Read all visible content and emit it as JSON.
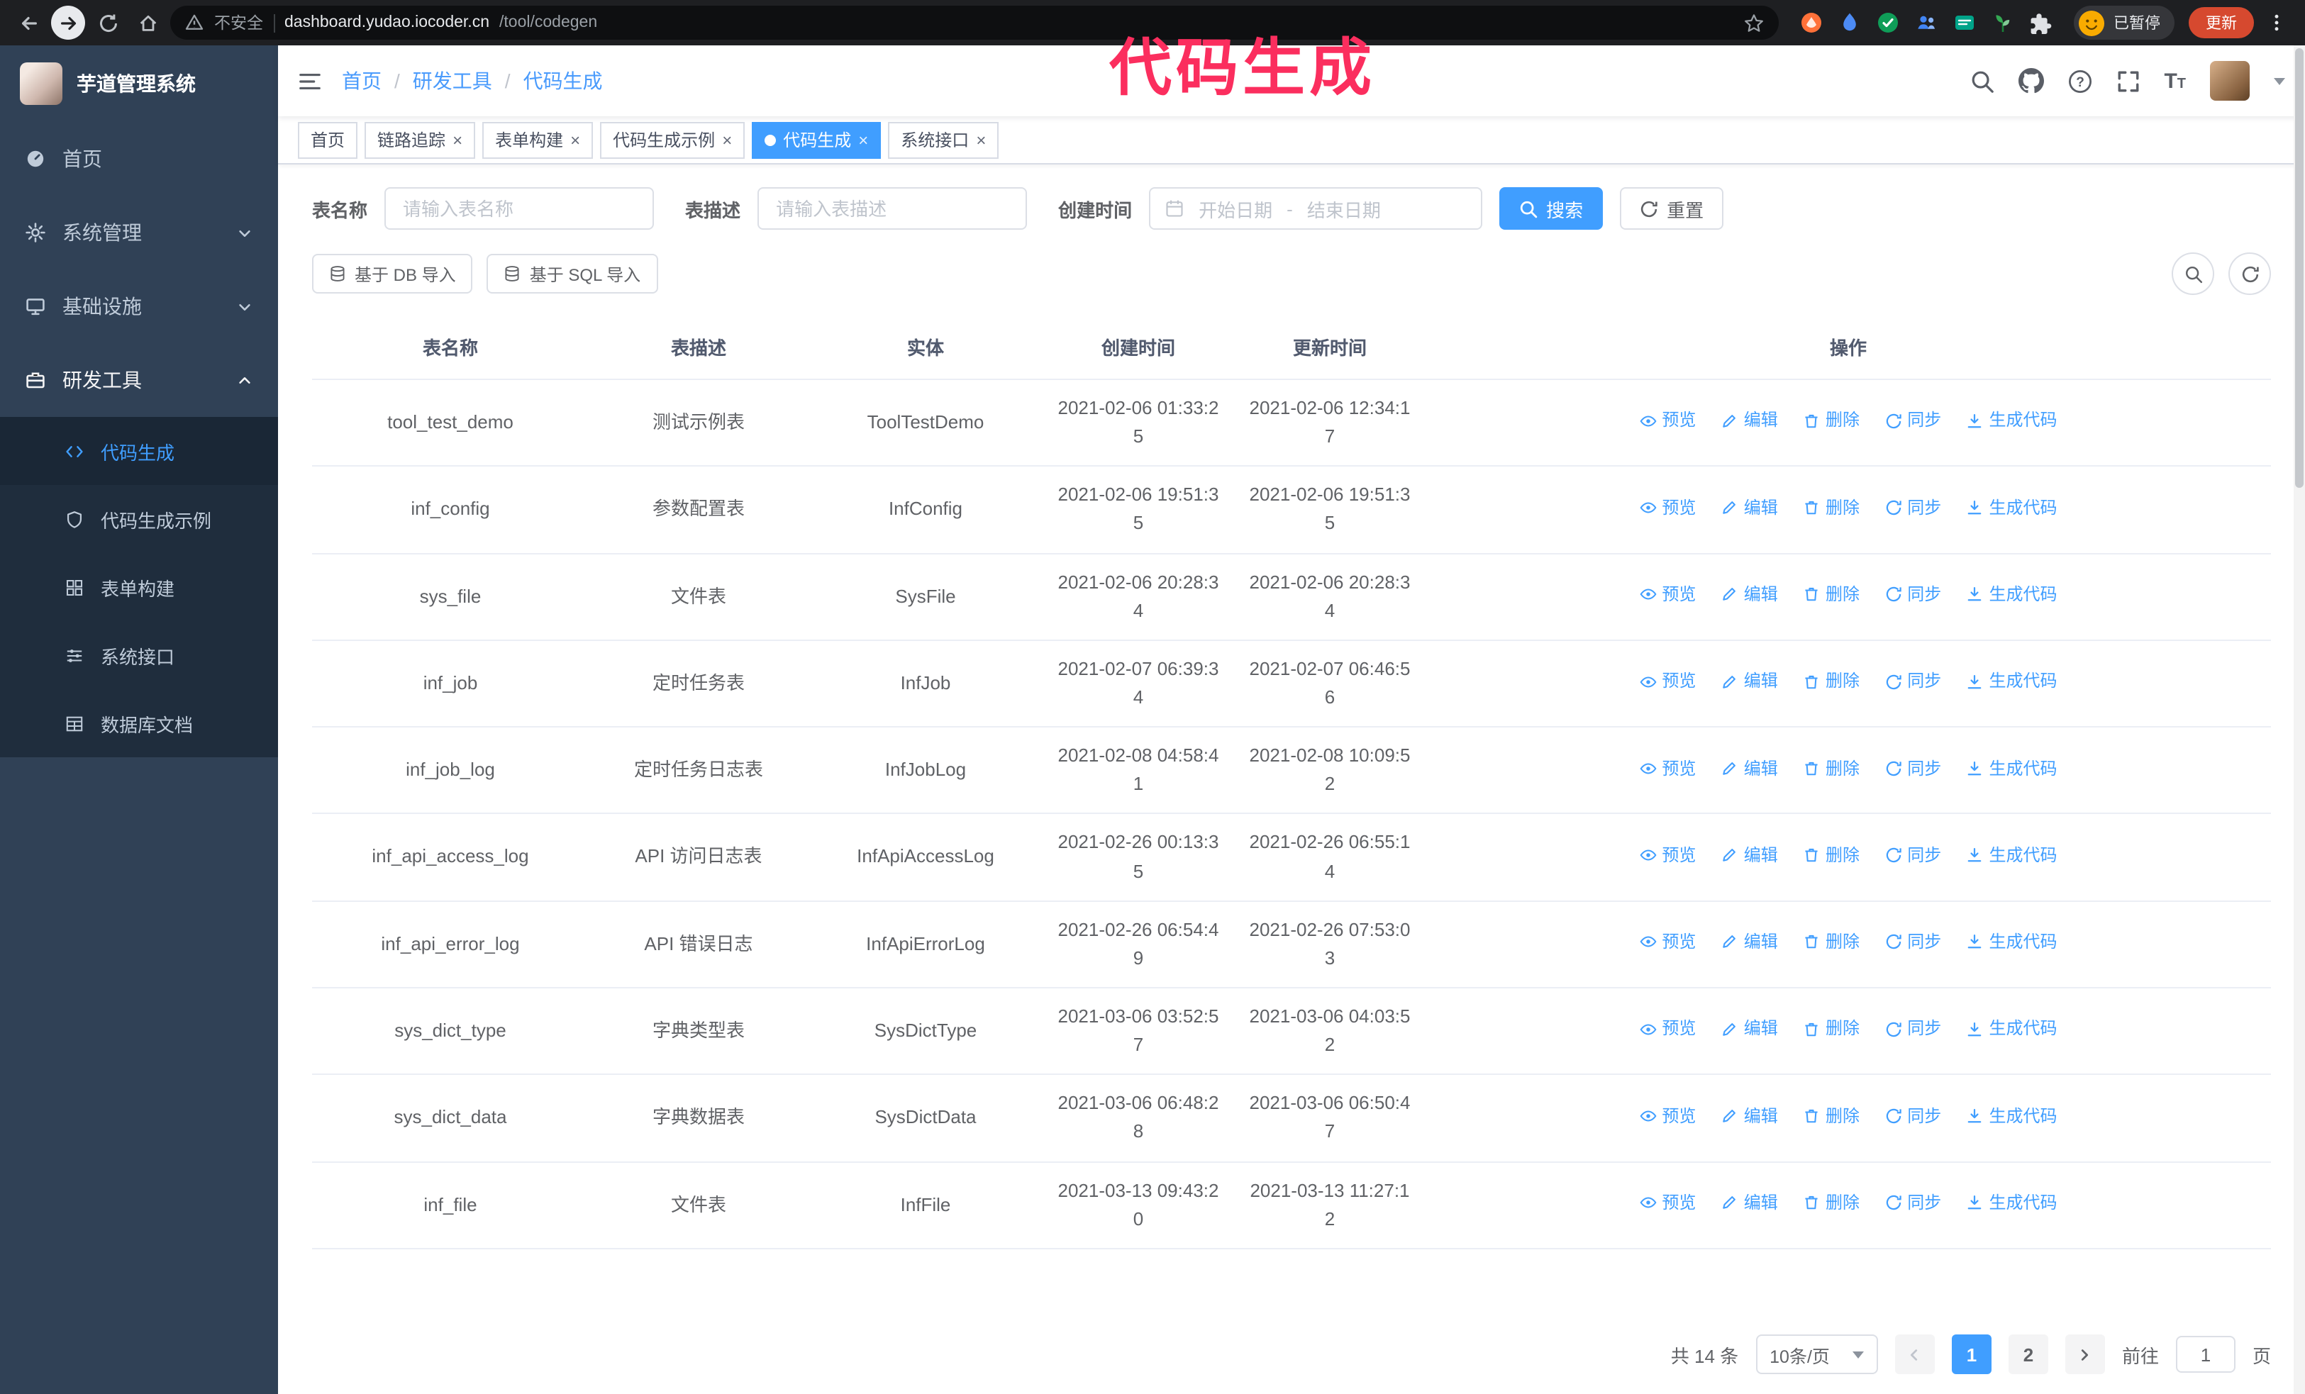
{
  "browser": {
    "security_label": "不安全",
    "url_domain": "dashboard.yudao.iocoder.cn",
    "url_path": "/tool/codegen",
    "profile_chip_label": "已暂停",
    "update_button_label": "更新"
  },
  "annotation": {
    "text": "代码生成"
  },
  "glyphs": {
    "close": "×"
  },
  "sidebar": {
    "title": "芋道管理系统",
    "items": [
      {
        "label": "首页"
      },
      {
        "label": "系统管理"
      },
      {
        "label": "基础设施"
      },
      {
        "label": "研发工具"
      }
    ],
    "sub_items": [
      {
        "label": "代码生成"
      },
      {
        "label": "代码生成示例"
      },
      {
        "label": "表单构建"
      },
      {
        "label": "系统接口"
      },
      {
        "label": "数据库文档"
      }
    ]
  },
  "breadcrumb": {
    "items": [
      "首页",
      "研发工具",
      "代码生成"
    ],
    "separator": "/"
  },
  "tabs": [
    {
      "label": "首页"
    },
    {
      "label": "链路追踪"
    },
    {
      "label": "表单构建"
    },
    {
      "label": "代码生成示例"
    },
    {
      "label": "代码生成"
    },
    {
      "label": "系统接口"
    }
  ],
  "filters": {
    "table_name_label": "表名称",
    "table_name_placeholder": "请输入表名称",
    "table_desc_label": "表描述",
    "table_desc_placeholder": "请输入表描述",
    "create_time_label": "创建时间",
    "start_date_placeholder": "开始日期",
    "range_separator": "-",
    "end_date_placeholder": "结束日期",
    "search_button": "搜索",
    "reset_button": "重置"
  },
  "toolbar": {
    "import_db_button": "基于 DB 导入",
    "import_sql_button": "基于 SQL 导入"
  },
  "table": {
    "columns": [
      "表名称",
      "表描述",
      "实体",
      "创建时间",
      "更新时间",
      "操作"
    ],
    "actions": [
      "预览",
      "编辑",
      "删除",
      "同步",
      "生成代码"
    ],
    "rows": [
      {
        "name": "tool_test_demo",
        "desc": "测试示例表",
        "entity": "ToolTestDemo",
        "created": "2021-02-06 01:33:25",
        "updated": "2021-02-06 12:34:17"
      },
      {
        "name": "inf_config",
        "desc": "参数配置表",
        "entity": "InfConfig",
        "created": "2021-02-06 19:51:35",
        "updated": "2021-02-06 19:51:35"
      },
      {
        "name": "sys_file",
        "desc": "文件表",
        "entity": "SysFile",
        "created": "2021-02-06 20:28:34",
        "updated": "2021-02-06 20:28:34"
      },
      {
        "name": "inf_job",
        "desc": "定时任务表",
        "entity": "InfJob",
        "created": "2021-02-07 06:39:34",
        "updated": "2021-02-07 06:46:56"
      },
      {
        "name": "inf_job_log",
        "desc": "定时任务日志表",
        "entity": "InfJobLog",
        "created": "2021-02-08 04:58:41",
        "updated": "2021-02-08 10:09:52"
      },
      {
        "name": "inf_api_access_log",
        "desc": "API 访问日志表",
        "entity": "InfApiAccessLog",
        "created": "2021-02-26 00:13:35",
        "updated": "2021-02-26 06:55:14"
      },
      {
        "name": "inf_api_error_log",
        "desc": "API 错误日志",
        "entity": "InfApiErrorLog",
        "created": "2021-02-26 06:54:49",
        "updated": "2021-02-26 07:53:03"
      },
      {
        "name": "sys_dict_type",
        "desc": "字典类型表",
        "entity": "SysDictType",
        "created": "2021-03-06 03:52:57",
        "updated": "2021-03-06 04:03:52"
      },
      {
        "name": "sys_dict_data",
        "desc": "字典数据表",
        "entity": "SysDictData",
        "created": "2021-03-06 06:48:28",
        "updated": "2021-03-06 06:50:47"
      },
      {
        "name": "inf_file",
        "desc": "文件表",
        "entity": "InfFile",
        "created": "2021-03-13 09:43:20",
        "updated": "2021-03-13 11:27:12"
      }
    ]
  },
  "pagination": {
    "total_label": "共 14 条",
    "page_size_label": "10条/页",
    "pages": [
      "1",
      "2"
    ],
    "goto_prefix": "前往",
    "goto_value": "1",
    "goto_suffix": "页"
  },
  "colors": {
    "accent": "#409eff",
    "annotation": "#fb2e5e",
    "sidebar_bg": "#304156",
    "submenu_bg": "#1f2d3d"
  }
}
